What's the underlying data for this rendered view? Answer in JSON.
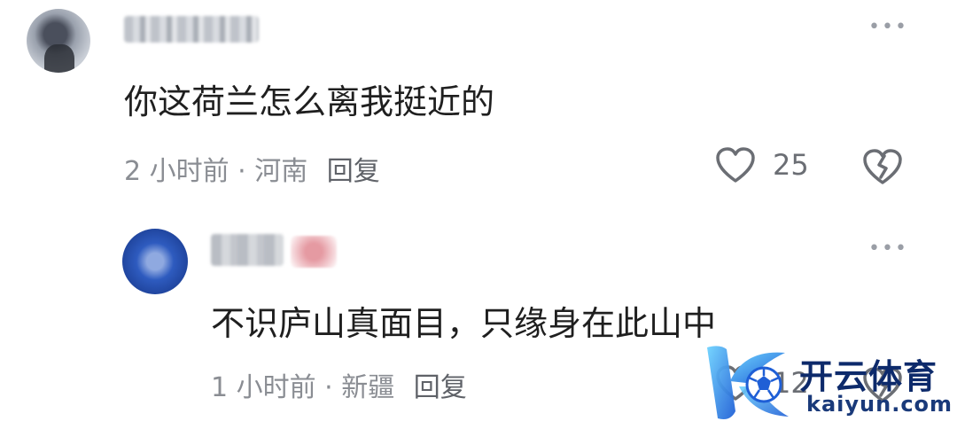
{
  "comments": [
    {
      "text": "你这荷兰怎么离我挺近的",
      "time": "2 小时前 · 河南",
      "reply_label": "回复",
      "like_count": "25"
    },
    {
      "text": "不识庐山真面目，只缘身在此山中",
      "time": "1 小时前 · 新疆",
      "reply_label": "回复",
      "like_count": "12"
    }
  ],
  "watermark": {
    "name_cn": "开云体育",
    "name_en": "kaiyun.com"
  },
  "icons": {
    "more": "more-dots-icon",
    "like": "heart-icon",
    "dislike": "broken-heart-icon"
  },
  "colors": {
    "text": "#1f1f1f",
    "meta": "#8a8d93",
    "icon": "#6b6e74",
    "watermark_blue": "#0d2a6b"
  }
}
